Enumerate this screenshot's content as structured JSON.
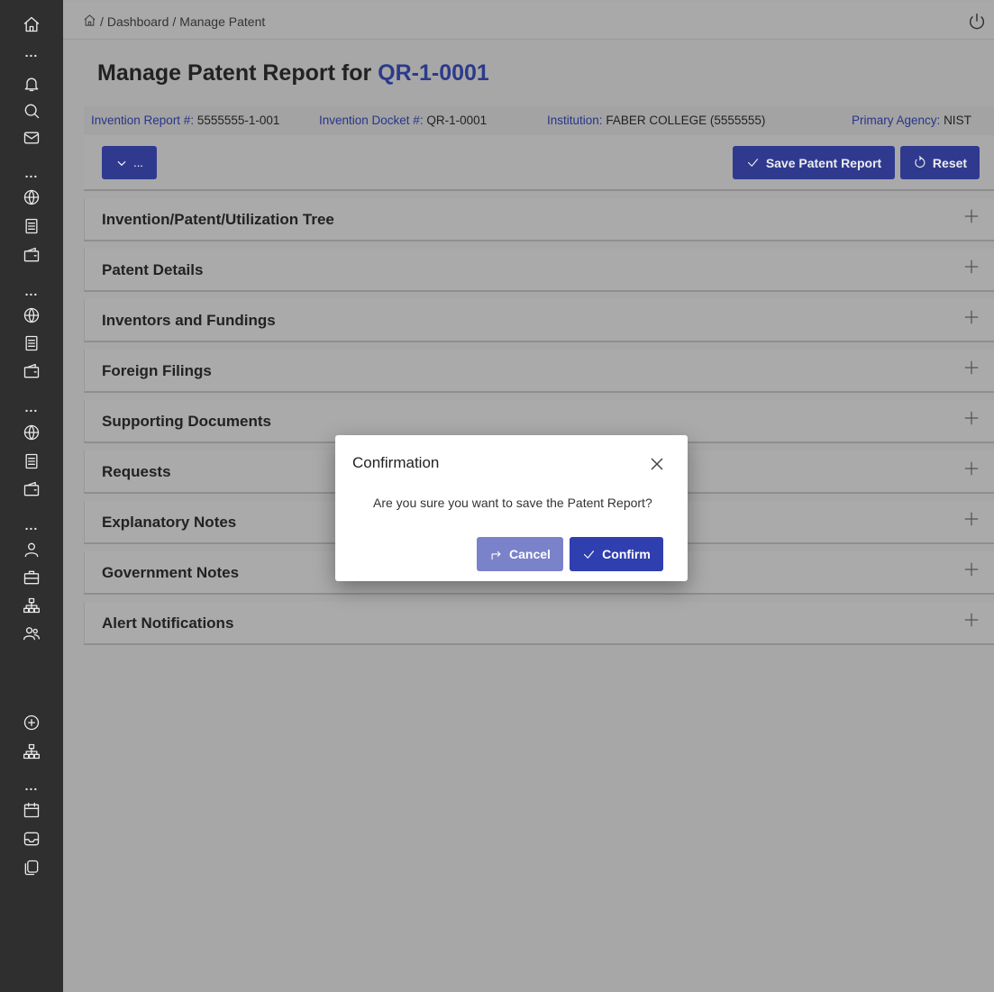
{
  "breadcrumb": {
    "home_icon": "home-icon",
    "separator": "/",
    "items": [
      "Dashboard",
      "Manage Patent"
    ]
  },
  "header": {
    "title_prefix": "Manage Patent Report for ",
    "title_id": "QR-1-0001"
  },
  "info": {
    "report_label": "Invention Report #:",
    "report_value": "5555555-1-001",
    "docket_label": "Invention Docket #:",
    "docket_value": "QR-1-0001",
    "institution_label": "Institution:",
    "institution_value": "FABER COLLEGE (5555555)",
    "agency_label": "Primary Agency:",
    "agency_value": "NIST"
  },
  "toolbar": {
    "more_label": "...",
    "save_label": "Save Patent Report",
    "reset_label": "Reset"
  },
  "panels": [
    {
      "title": "Invention/Patent/Utilization Tree"
    },
    {
      "title": "Patent Details"
    },
    {
      "title": "Inventors and Fundings"
    },
    {
      "title": "Foreign Filings"
    },
    {
      "title": "Supporting Documents"
    },
    {
      "title": "Requests"
    },
    {
      "title": "Explanatory Notes"
    },
    {
      "title": "Government Notes"
    },
    {
      "title": "Alert Notifications"
    }
  ],
  "modal": {
    "title": "Confirmation",
    "message": "Are you sure you want to save the Patent Report?",
    "cancel_label": "Cancel",
    "confirm_label": "Confirm"
  },
  "colors": {
    "accent": "#2f3a8f",
    "sidebar": "#2f2f2f",
    "overlay_bg": "#a7a7a7"
  }
}
